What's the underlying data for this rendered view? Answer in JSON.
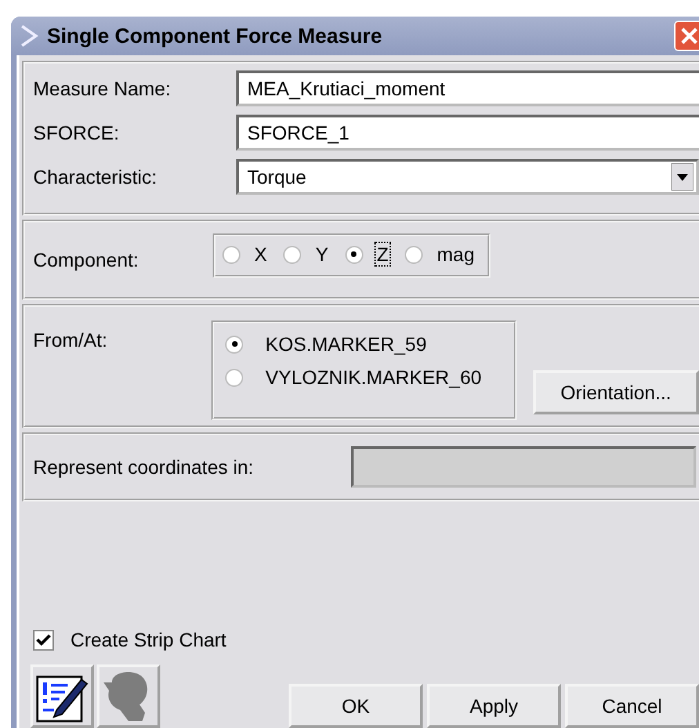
{
  "window": {
    "title": "Single Component Force Measure"
  },
  "fields": [
    {
      "label": "Measure Name:",
      "value": "MEA_Krutiaci_moment",
      "kind": "text"
    },
    {
      "label": "SFORCE:",
      "value": "SFORCE_1",
      "kind": "text"
    },
    {
      "label": "Characteristic:",
      "value": "Torque",
      "kind": "dropdown"
    }
  ],
  "component": {
    "label": "Component:",
    "options": [
      {
        "label": "X",
        "selected": false,
        "focused": false
      },
      {
        "label": "Y",
        "selected": false,
        "focused": false
      },
      {
        "label": "Z",
        "selected": true,
        "focused": true
      },
      {
        "label": "mag",
        "selected": false,
        "focused": false
      }
    ]
  },
  "from_at": {
    "label": "From/At:",
    "options": [
      {
        "label": "KOS.MARKER_59",
        "selected": true
      },
      {
        "label": "VYLOZNIK.MARKER_60",
        "selected": false
      }
    ],
    "button": "Orientation..."
  },
  "represent": {
    "label": "Represent coordinates in:",
    "disabled": true
  },
  "strip_chart": {
    "label": "Create Strip Chart",
    "checked": true
  },
  "buttons": [
    "OK",
    "Apply",
    "Cancel"
  ]
}
